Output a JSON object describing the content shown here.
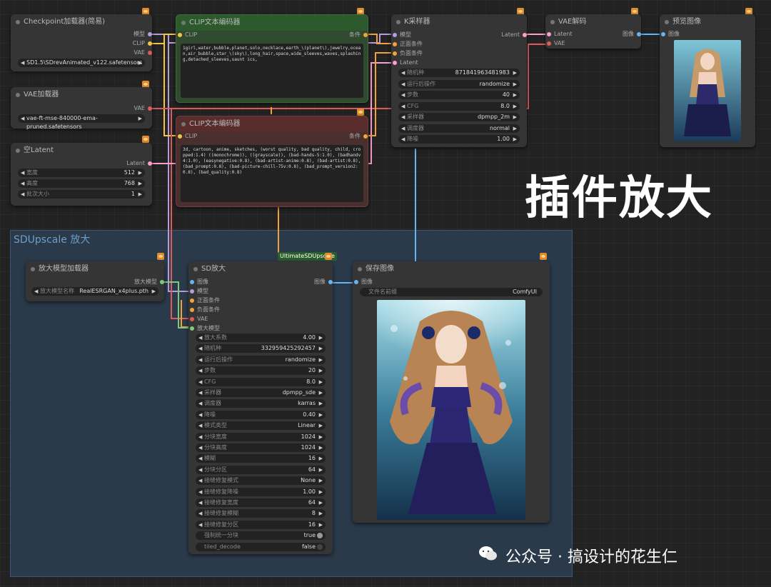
{
  "group": {
    "title": "SDUpscale 放大"
  },
  "ckpt": {
    "title": "Checkpoint加载器(简易)",
    "out_model": "模型",
    "out_clip": "CLIP",
    "out_vae": "VAE",
    "ckpt_name": "SD1.5\\SDrevAnimated_v122.safetensors"
  },
  "vae_loader": {
    "title": "VAE加载器",
    "out_vae": "VAE",
    "vae_name": "vae-ft-mse-840000-ema-pruned.safetensors"
  },
  "latent": {
    "title": "空Latent",
    "out": "Latent",
    "w_label": "宽度",
    "w_val": "512",
    "h_label": "高度",
    "h_val": "768",
    "b_label": "批次大小",
    "b_val": "1"
  },
  "clip_pos": {
    "title": "CLIP文本编码器",
    "in": "CLIP",
    "out": "条件",
    "text": "1girl,water,bubble,planet,solo,necklace,earth_\\(planet\\),jewelry,ocean,air_bubble,star_\\(sky\\),long_hair,space,wide_sleeves,waves,splashing,detached_sleeves,saunt ics,"
  },
  "clip_neg": {
    "title": "CLIP文本编码器",
    "in": "CLIP",
    "out": "条件",
    "text": "3d, cartoon, anime, sketches, (worst quality, bad quality, child, cropped:1.4) ((monochrome)), ((grayscale)), (bad-hands-5:1.0), (badhandv4:1.0), (easynegative:0.8), (bad-artist-anime:0.8), (bad-artist:0.8), (bad_prompt:0.8), (bad-picture-chill-75v:0.8), (bad_prompt_version2:0.8), (bad_quality:0.8)"
  },
  "ksampler": {
    "title": "K采样器",
    "in_model": "模型",
    "in_pos": "正面条件",
    "in_neg": "负面条件",
    "in_latent": "Latent",
    "out": "Latent",
    "widgets": [
      {
        "label": "随机种",
        "value": "871841963481983"
      },
      {
        "label": "运行后操作",
        "value": "randomize"
      },
      {
        "label": "步数",
        "value": "40"
      },
      {
        "label": "CFG",
        "value": "8.0"
      },
      {
        "label": "采样器",
        "value": "dpmpp_2m"
      },
      {
        "label": "调度器",
        "value": "normal"
      },
      {
        "label": "降噪",
        "value": "1.00"
      }
    ]
  },
  "vae_decode": {
    "title": "VAE解码",
    "in_latent": "Latent",
    "in_vae": "VAE",
    "out": "图像"
  },
  "preview": {
    "title": "预览图像",
    "in": "图像"
  },
  "upmodel": {
    "title": "放大模型加载器",
    "out": "放大模型",
    "w_label": "放大模型名称",
    "w_val": "RealESRGAN_x4plus.pth"
  },
  "sdup": {
    "title": "SD放大",
    "badge": "UltimateSDUpscale",
    "in_image": "图像",
    "in_model": "模型",
    "in_pos": "正面条件",
    "in_neg": "负面条件",
    "in_vae": "VAE",
    "in_upmodel": "放大模型",
    "out": "图像",
    "widgets": [
      {
        "label": "放大系数",
        "value": "4.00"
      },
      {
        "label": "随机种",
        "value": "332959425292457"
      },
      {
        "label": "运行后操作",
        "value": "randomize"
      },
      {
        "label": "步数",
        "value": "20"
      },
      {
        "label": "CFG",
        "value": "8.0"
      },
      {
        "label": "采样器",
        "value": "dpmpp_sde"
      },
      {
        "label": "调度器",
        "value": "karras"
      },
      {
        "label": "降噪",
        "value": "0.40"
      },
      {
        "label": "模式类型",
        "value": "Linear"
      },
      {
        "label": "分块宽度",
        "value": "1024"
      },
      {
        "label": "分块高度",
        "value": "1024"
      },
      {
        "label": "模糊",
        "value": "16"
      },
      {
        "label": "分块分区",
        "value": "64"
      },
      {
        "label": "接缝修复模式",
        "value": "None"
      },
      {
        "label": "接缝修复降噪",
        "value": "1.00"
      },
      {
        "label": "接缝修复宽度",
        "value": "64"
      },
      {
        "label": "接缝修复模糊",
        "value": "8"
      },
      {
        "label": "接缝修复分区",
        "value": "16"
      }
    ],
    "toggles": [
      {
        "label": "强制统一分块",
        "value": "true"
      },
      {
        "label": "tiled_decode",
        "value": "false"
      }
    ]
  },
  "save": {
    "title": "保存图像",
    "in": "图像",
    "w_label": "文件名前缀",
    "w_val": "ComfyUI"
  },
  "overlay": {
    "title": "插件放大",
    "watermark": "公众号 · 搞设计的花生仁"
  }
}
